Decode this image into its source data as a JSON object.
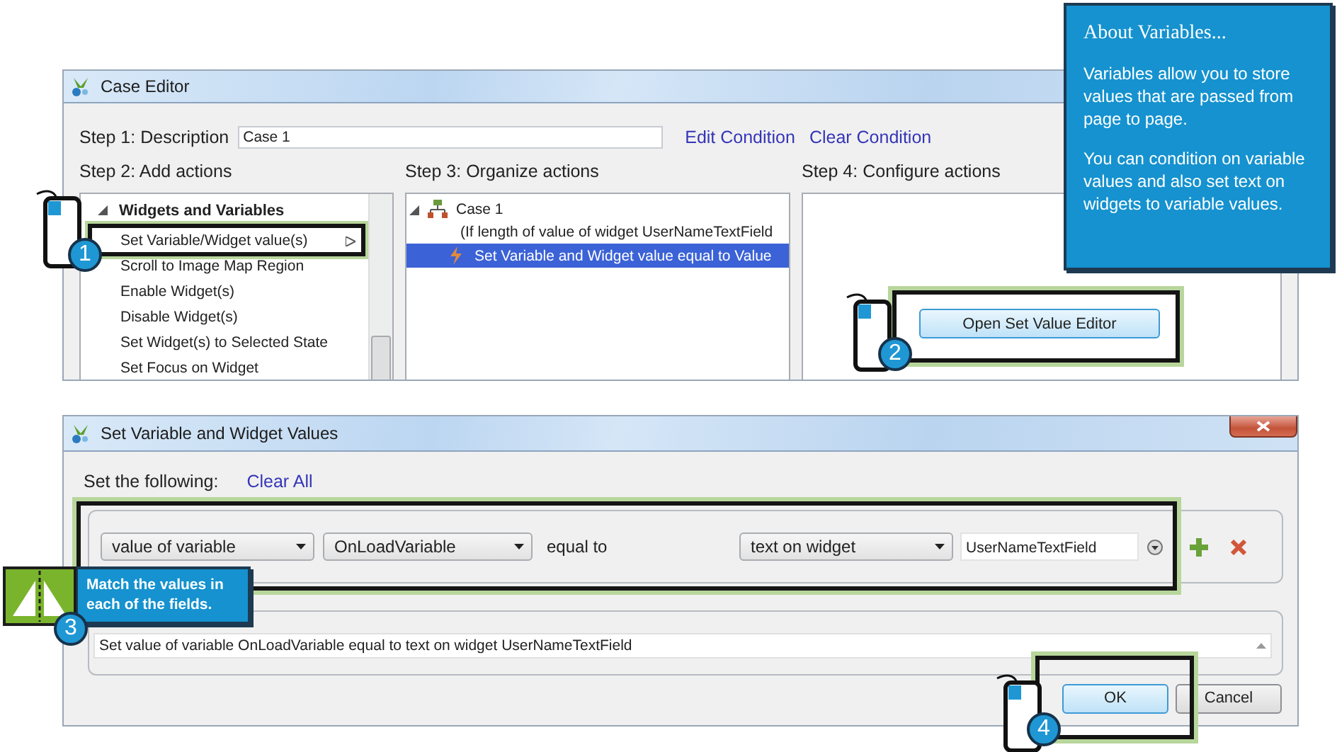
{
  "case_editor": {
    "title": "Case Editor",
    "step1_label": "Step 1: Description",
    "description": "Case 1",
    "links": [
      "Edit Condition",
      "Clear Condition"
    ],
    "step2_label": "Step 2: Add actions",
    "step3_label": "Step 3: Organize actions",
    "step4_label": "Step 4: Configure actions",
    "actions_tree": {
      "label": "Widgets and Variables",
      "expanded": true,
      "children": [
        {
          "label": "Set Variable/Widget value(s)",
          "submenu": true
        },
        {
          "label": "Scroll to Image Map Region",
          "submenu": false
        },
        {
          "label": "Enable Widget(s)",
          "submenu": false
        },
        {
          "label": "Disable Widget(s)",
          "submenu": false
        },
        {
          "label": "Set Widget(s) to Selected State",
          "submenu": false
        },
        {
          "label": "Set Focus on Widget",
          "submenu": false
        }
      ]
    },
    "organize_tree": {
      "label": "Case 1",
      "expanded": true,
      "condition": "(If length of value of widget UserNameTextField",
      "children": [
        {
          "label": "Set Variable and Widget value equal to Value",
          "selected": true
        }
      ]
    },
    "configure_button": "Open Set Value Editor"
  },
  "about_callout": {
    "title": "About Variables...",
    "paragraphs": [
      "Variables allow you to store values that are passed from page to page.",
      "You can condition on variable values and also set text on widgets to variable values."
    ]
  },
  "set_values_dialog": {
    "title": "Set Variable and Widget Values",
    "set_label": "Set the following:",
    "clear_link": "Clear All",
    "rows": [
      {
        "target_type": "value of variable",
        "target": "OnLoadVariable",
        "operator": "equal to",
        "source_type": "text on widget",
        "source": "UserNameTextField"
      }
    ],
    "summary": "Set value of variable OnLoadVariable equal to text on widget UserNameTextField",
    "buttons": [
      {
        "label": "OK",
        "default": true
      },
      {
        "label": "Cancel",
        "default": false
      }
    ]
  },
  "match_callout": {
    "text": "Match the values in each of the fields."
  },
  "step_badges": [
    {
      "number": "1",
      "kind": "mouse"
    },
    {
      "number": "2",
      "kind": "mouse"
    },
    {
      "number": "3",
      "kind": "flag"
    },
    {
      "number": "4",
      "kind": "mouse"
    }
  ]
}
